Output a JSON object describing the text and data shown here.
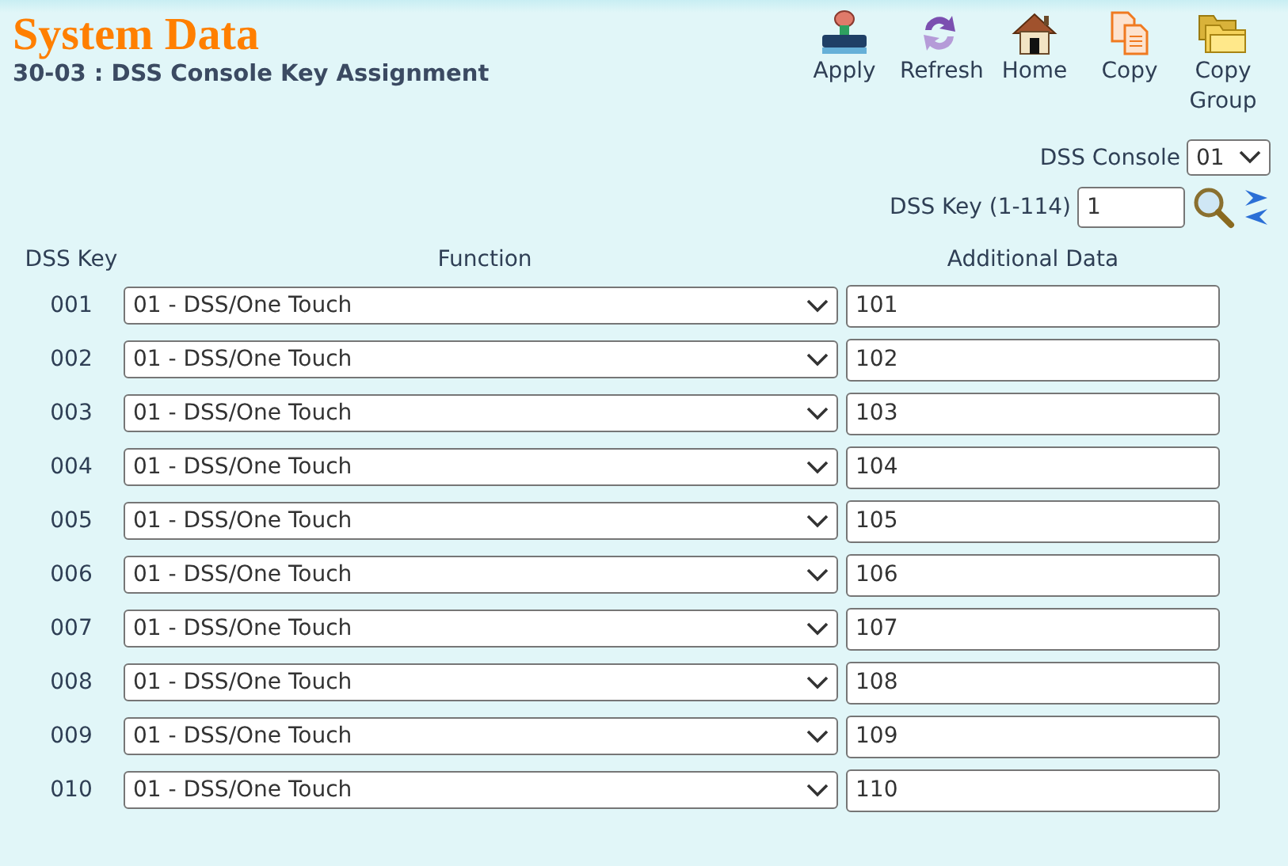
{
  "header": {
    "title": "System Data",
    "subtitle": "30-03 : DSS Console Key Assignment"
  },
  "toolbar": [
    {
      "kind": "apply",
      "label": "Apply"
    },
    {
      "kind": "refresh",
      "label": "Refresh"
    },
    {
      "kind": "home",
      "label": "Home"
    },
    {
      "kind": "copy",
      "label": "Copy"
    },
    {
      "kind": "copy_group",
      "label": "Copy Group"
    }
  ],
  "console": {
    "label": "DSS Console",
    "value": "01"
  },
  "key_search": {
    "label": "DSS Key (1-114)",
    "value": "1"
  },
  "table": {
    "columns": [
      "DSS Key",
      "Function",
      "Additional Data"
    ],
    "rows": [
      {
        "key": "001",
        "function": "01 - DSS/One Touch",
        "data": "101"
      },
      {
        "key": "002",
        "function": "01 - DSS/One Touch",
        "data": "102"
      },
      {
        "key": "003",
        "function": "01 - DSS/One Touch",
        "data": "103"
      },
      {
        "key": "004",
        "function": "01 - DSS/One Touch",
        "data": "104"
      },
      {
        "key": "005",
        "function": "01 - DSS/One Touch",
        "data": "105"
      },
      {
        "key": "006",
        "function": "01 - DSS/One Touch",
        "data": "106"
      },
      {
        "key": "007",
        "function": "01 - DSS/One Touch",
        "data": "107"
      },
      {
        "key": "008",
        "function": "01 - DSS/One Touch",
        "data": "108"
      },
      {
        "key": "009",
        "function": "01 - DSS/One Touch",
        "data": "109"
      },
      {
        "key": "010",
        "function": "01 - DSS/One Touch",
        "data": "110"
      }
    ]
  }
}
